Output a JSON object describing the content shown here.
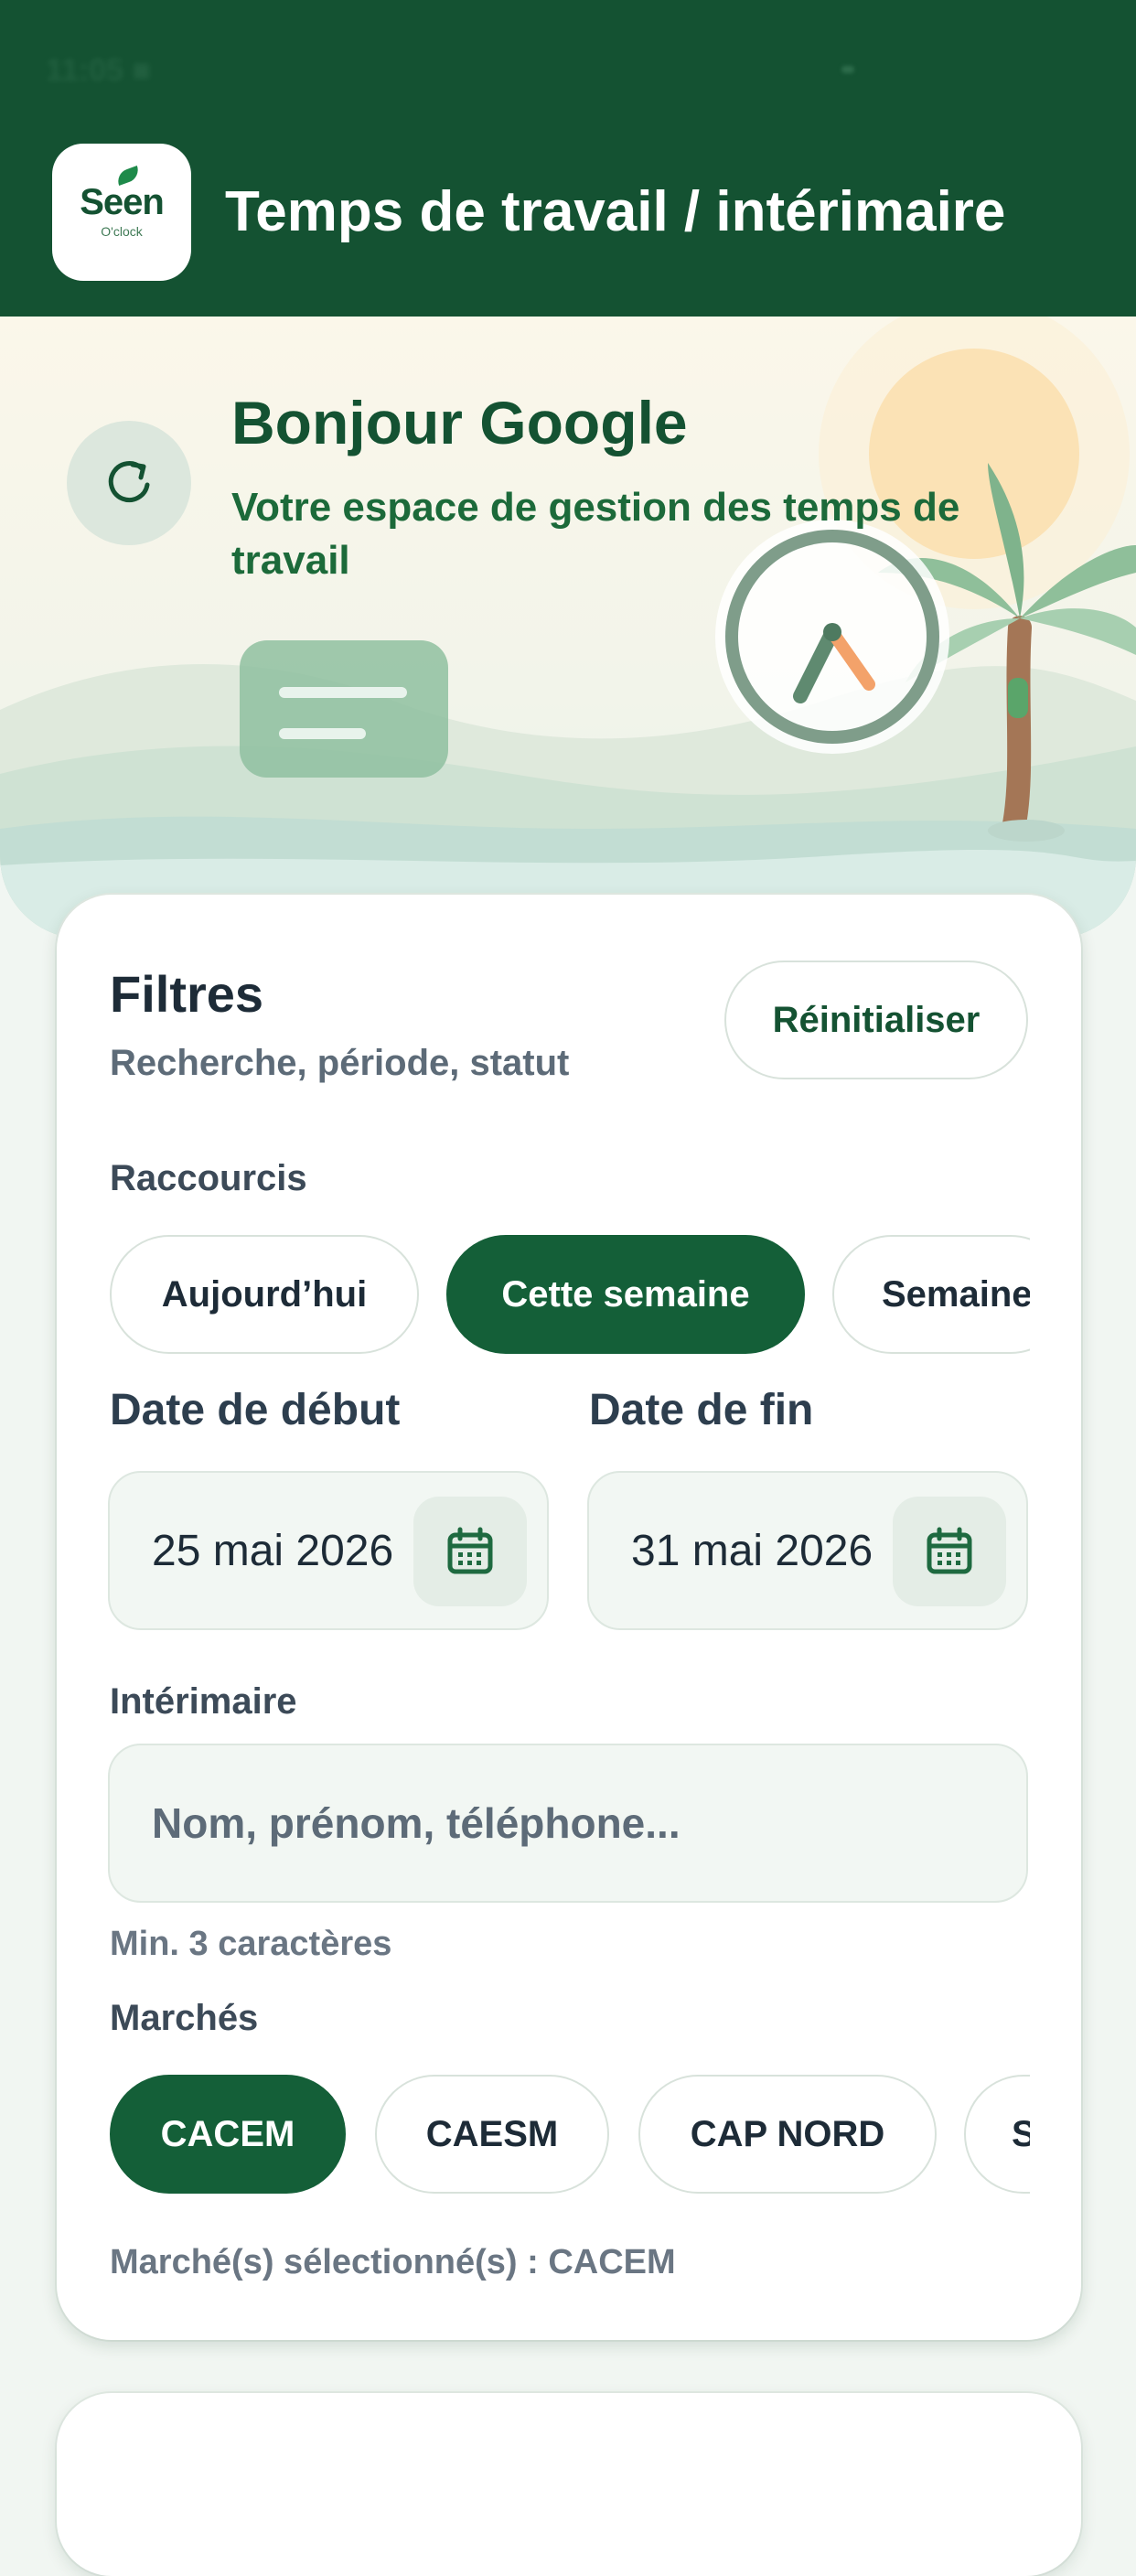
{
  "app_bar": {
    "title": "Temps de travail / intérimaire",
    "logo_text": "Seen",
    "logo_subtext": "O'clock"
  },
  "hero": {
    "greeting": "Bonjour Google",
    "subtitle": "Votre espace de gestion des temps de travail"
  },
  "filters": {
    "title": "Filtres",
    "subtitle": "Recherche, période, statut",
    "reset_label": "Réinitialiser",
    "shortcuts_label": "Raccourcis",
    "shortcuts": [
      {
        "label": "Aujourd’hui",
        "active": false
      },
      {
        "label": "Cette semaine",
        "active": true
      },
      {
        "label": "Semaine",
        "active": false
      }
    ],
    "start_date_label": "Date de début",
    "start_date_value": "25 mai 2026",
    "end_date_label": "Date de fin",
    "end_date_value": "31 mai 2026",
    "temp_worker_label": "Intérimaire",
    "temp_worker_placeholder": "Nom, prénom, téléphone...",
    "temp_worker_hint": "Min. 3 caractères",
    "markets_label": "Marchés",
    "markets": [
      {
        "label": "CACEM",
        "active": true
      },
      {
        "label": "CAESM",
        "active": false
      },
      {
        "label": "CAP NORD",
        "active": false
      },
      {
        "label": "S",
        "active": false
      }
    ],
    "selected_markets_text": "Marché(s) sélectionné(s) : CACEM"
  },
  "colors": {
    "primary": "#145232",
    "chip_active": "#145f38",
    "background": "#f1f6f2"
  },
  "icons": {
    "refresh": "refresh-icon",
    "calendar": "calendar-icon"
  }
}
